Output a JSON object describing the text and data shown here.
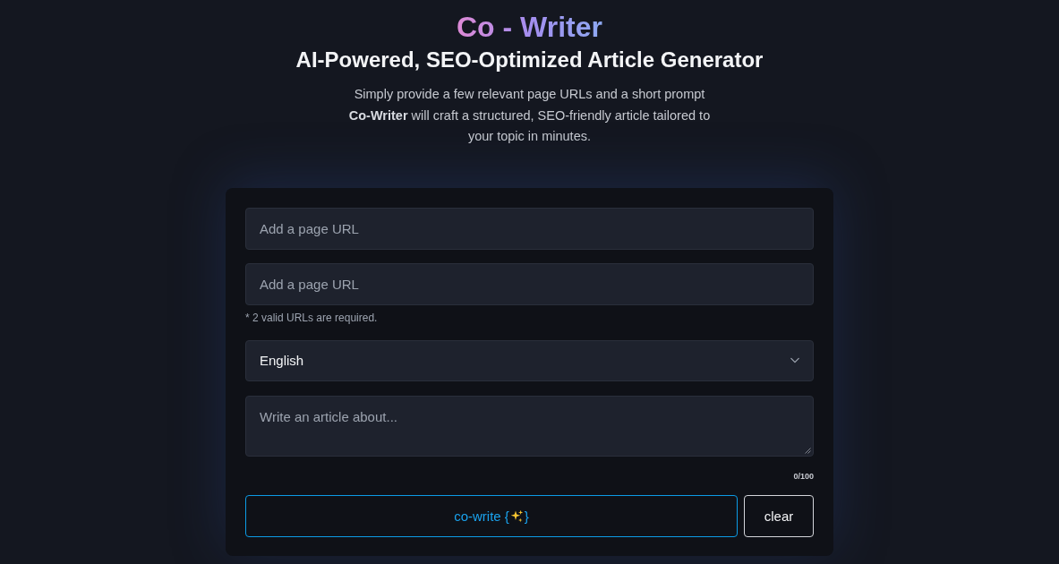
{
  "header": {
    "title": "Co - Writer",
    "subtitle": "AI-Powered, SEO-Optimized Article Generator",
    "description": "Simply provide a few relevant page URLs and a short prompt **Co-Writer** will craft a structured, SEO-friendly article tailored to your topic in minutes."
  },
  "form": {
    "url_fields": [
      {
        "placeholder": "Add a page URL"
      },
      {
        "placeholder": "Add a page URL"
      }
    ],
    "url_hint": "* 2 valid URLs are required.",
    "language_select": {
      "value": "English"
    },
    "prompt_field": {
      "placeholder": "Write an article about..."
    },
    "char_counter": "0/100",
    "buttons": [
      {
        "kind": "primary",
        "label": "co-write {",
        "label_end": "}"
      },
      {
        "kind": "secondary",
        "label": "clear"
      }
    ]
  }
}
